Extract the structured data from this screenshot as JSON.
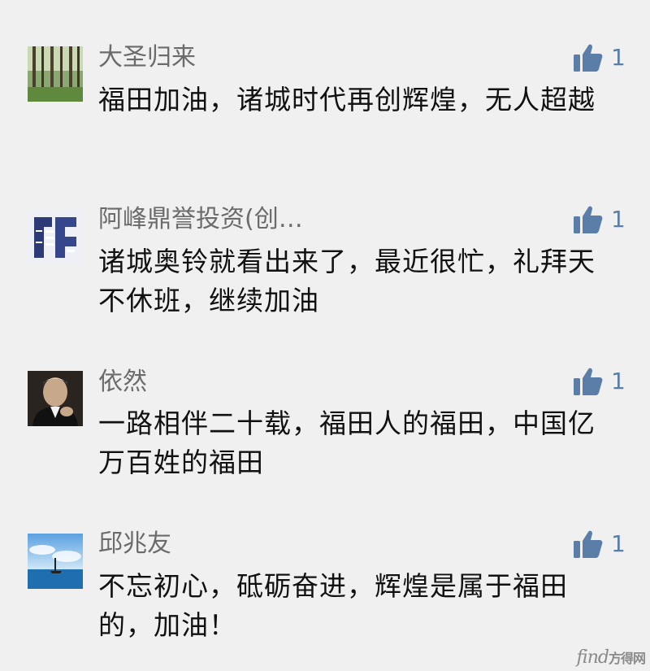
{
  "comments": [
    {
      "user": "大圣归来",
      "avatar_icon": "forest-avatar",
      "likes": "1",
      "text": "福田加油，诸城时代再创辉煌，无人超越"
    },
    {
      "user": "阿峰鼎誉投资(创…",
      "avatar_icon": "logo-avatar",
      "likes": "1",
      "text": "诸城奥铃就看出来了，最近很忙，礼拜天不休班，继续加油"
    },
    {
      "user": "依然",
      "avatar_icon": "portrait-avatar",
      "likes": "1",
      "text": "一路相伴二十载，福田人的福田，中国亿万百姓的福田"
    },
    {
      "user": "邱兆友",
      "avatar_icon": "sea-sailboat-avatar",
      "likes": "1",
      "text": "不忘初心，砥砺奋进，辉煌是属于福田的，加油！"
    }
  ],
  "watermark": {
    "text": "find",
    "brand": "方得网"
  },
  "colors": {
    "background": "#f0f0f0",
    "username": "#6b6b6b",
    "like_blue": "#5b7ea8",
    "text": "#111111"
  }
}
